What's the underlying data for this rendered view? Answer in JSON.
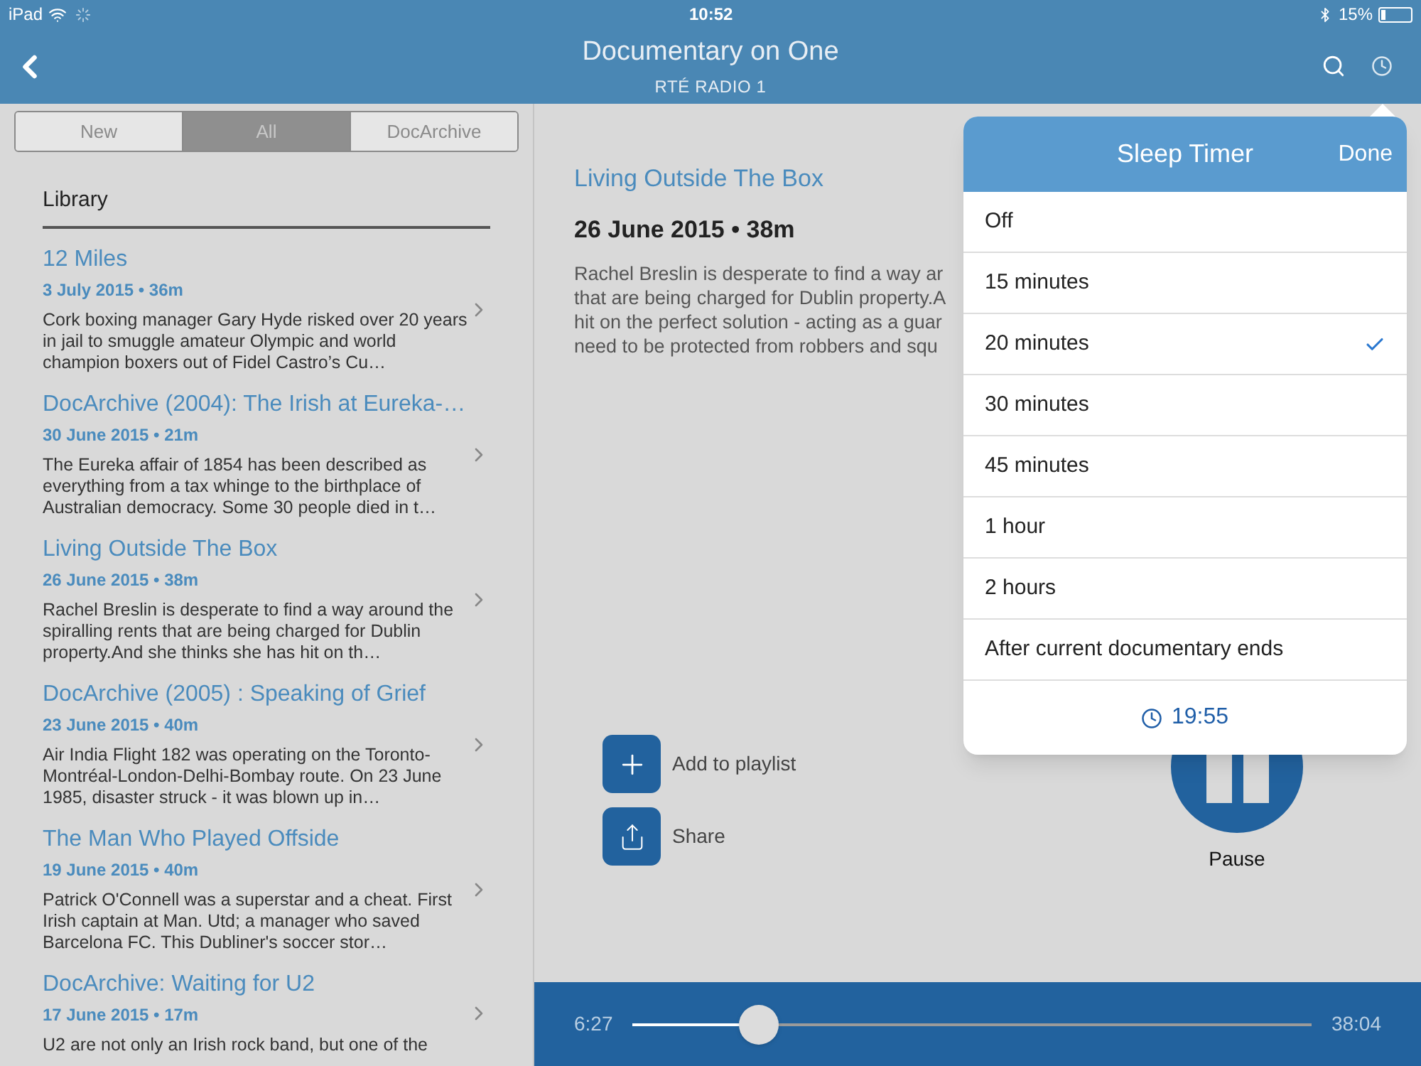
{
  "status_bar": {
    "device": "iPad",
    "time": "10:52",
    "battery_text": "15%"
  },
  "nav": {
    "title": "Documentary on One",
    "subtitle": "RTÉ RADIO 1"
  },
  "segments": [
    {
      "label": "New",
      "selected": false
    },
    {
      "label": "All",
      "selected": true
    },
    {
      "label": "DocArchive",
      "selected": false
    }
  ],
  "library": {
    "heading": "Library",
    "items": [
      {
        "title": "12 Miles",
        "meta": "3 July 2015 • 36m",
        "summary": "Cork boxing manager Gary Hyde risked over 20 years in jail to smuggle amateur Olympic and world champion boxers out of Fidel Castro’s Cu…"
      },
      {
        "title": "DocArchive (2004): The Irish at Eureka-…",
        "meta": "30 June 2015 • 21m",
        "summary": "The Eureka affair of 1854 has been described as everything from a tax whinge to the birthplace of Australian democracy. Some 30 people died in t…"
      },
      {
        "title": "Living Outside The Box",
        "meta": "26 June 2015 • 38m",
        "summary": "Rachel Breslin is desperate to find a way around the spiralling rents that are being charged for Dublin property.And she thinks she has hit on th…"
      },
      {
        "title": "DocArchive (2005) : Speaking of Grief",
        "meta": "23 June 2015 • 40m",
        "summary": "Air India Flight 182 was operating on the Toronto-Montréal-London-Delhi-Bombay route. On 23 June 1985, disaster struck - it was blown up in…"
      },
      {
        "title": "The Man Who Played Offside",
        "meta": "19 June 2015 • 40m",
        "summary": "Patrick O'Connell was a superstar and a cheat. First Irish captain at Man. Utd; a manager who saved Barcelona FC. This Dubliner's soccer stor…"
      },
      {
        "title": "DocArchive: Waiting for U2",
        "meta": "17 June 2015 • 17m",
        "summary": "U2 are not only an Irish rock band, but one of the"
      }
    ]
  },
  "detail": {
    "title": "Living Outside The Box",
    "meta": "26 June 2015 • 38m",
    "description_lines": [
      "Rachel Breslin is desperate to find a way ar",
      "that are being charged for Dublin property.A",
      "hit on the perfect solution - acting as a guar",
      "need to be protected from robbers and squ"
    ],
    "actions": [
      {
        "kind": "add",
        "label": "Add to playlist"
      },
      {
        "kind": "share",
        "label": "Share"
      }
    ],
    "play_label": "Pause"
  },
  "player": {
    "elapsed": "6:27",
    "duration": "38:04",
    "level": 0.186
  },
  "sleep_timer": {
    "title": "Sleep Timer",
    "done": "Done",
    "options": [
      {
        "label": "Off",
        "selected": false
      },
      {
        "label": "15 minutes",
        "selected": false
      },
      {
        "label": "20 minutes",
        "selected": true
      },
      {
        "label": "30 minutes",
        "selected": false
      },
      {
        "label": "45 minutes",
        "selected": false
      },
      {
        "label": "1 hour",
        "selected": false
      },
      {
        "label": "2 hours",
        "selected": false
      },
      {
        "label": "After current documentary ends",
        "selected": false
      }
    ],
    "end_time": "19:55"
  }
}
